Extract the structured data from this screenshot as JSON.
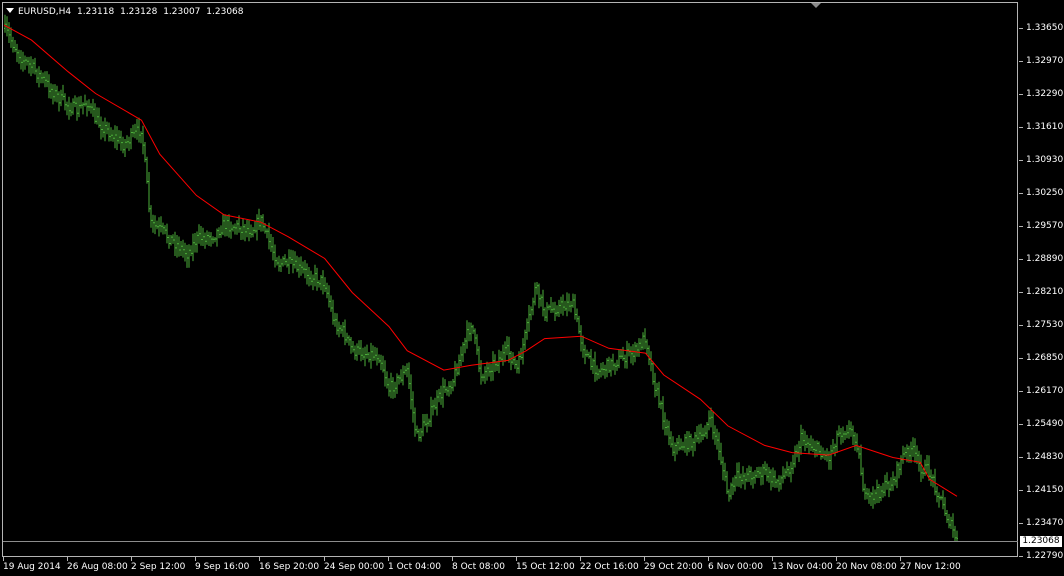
{
  "chart_header": {
    "symbol_timeframe": "EURUSD,H4",
    "open": "1.23118",
    "high": "1.23128",
    "low": "1.23007",
    "close": "1.23068"
  },
  "price_axis": {
    "labels": [
      "1.33650",
      "1.32970",
      "1.32290",
      "1.31610",
      "1.30930",
      "1.30250",
      "1.29570",
      "1.28890",
      "1.28210",
      "1.27530",
      "1.26850",
      "1.26170",
      "1.25490",
      "1.24830",
      "1.24150",
      "1.23470",
      "1.22790"
    ],
    "current_price": "1.23068"
  },
  "time_axis": {
    "labels": [
      "19 Aug 2014",
      "26 Aug 08:00",
      "2 Sep 12:00",
      "9 Sep 16:00",
      "16 Sep 20:00",
      "24 Sep 00:00",
      "1 Oct 04:00",
      "8 Oct 08:00",
      "15 Oct 12:00",
      "22 Oct 16:00",
      "29 Oct 20:00",
      "6 Nov 00:00",
      "13 Nov 04:00",
      "20 Nov 08:00",
      "27 Nov 12:00"
    ]
  },
  "colors": {
    "background": "#000000",
    "bars": "#4caf3a",
    "moving_average": "#ff0000",
    "axis_text": "#ffffff",
    "grid_frame": "#b4b4b4"
  },
  "chart_data": {
    "type": "line",
    "bar_style": "ohlc",
    "symbol": "EURUSD",
    "timeframe": "H4",
    "ylim": [
      1.2279,
      1.3404
    ],
    "x_start": "19 Aug 2014",
    "x_end": "1 Dec 2014",
    "series": [
      {
        "style": "ohlc-bars",
        "close_path": [
          [
            "19 Aug 2014",
            1.3364
          ],
          [
            "21 Aug 2014",
            1.33
          ],
          [
            "22 Aug 2014",
            1.3285
          ],
          [
            "25 Aug 2014",
            1.322
          ],
          [
            "26 Aug 2014",
            1.3205
          ],
          [
            "27 Aug 2014",
            1.3195
          ],
          [
            "28 Aug 2014",
            1.3215
          ],
          [
            "29 Aug 2014",
            1.3175
          ],
          [
            "1 Sep 2014",
            1.3125
          ],
          [
            "2 Sep 2014",
            1.314
          ],
          [
            "3 Sep 2014",
            1.316
          ],
          [
            "4 Sep 2014",
            1.296
          ],
          [
            "5 Sep 2014",
            1.295
          ],
          [
            "8 Sep 2014",
            1.29
          ],
          [
            "9 Sep 2014",
            1.293
          ],
          [
            "10 Sep 2014",
            1.2935
          ],
          [
            "11 Sep 2014",
            1.294
          ],
          [
            "12 Sep 2014",
            1.296
          ],
          [
            "15 Sep 2014",
            1.295
          ],
          [
            "16 Sep 2014",
            1.297
          ],
          [
            "17 Sep 2014",
            1.292
          ],
          [
            "18 Sep 2014",
            1.288
          ],
          [
            "19 Sep 2014",
            1.288
          ],
          [
            "22 Sep 2014",
            1.285
          ],
          [
            "23 Sep 2014",
            1.284
          ],
          [
            "24 Sep 2014",
            1.276
          ],
          [
            "25 Sep 2014",
            1.274
          ],
          [
            "26 Sep 2014",
            1.27
          ],
          [
            "29 Sep 2014",
            1.269
          ],
          [
            "30 Sep 2014",
            1.262
          ],
          [
            "1 Oct 2014",
            1.264
          ],
          [
            "2 Oct 2014",
            1.266
          ],
          [
            "3 Oct 2014",
            1.252
          ],
          [
            "6 Oct 2014",
            1.262
          ],
          [
            "7 Oct 2014",
            1.264
          ],
          [
            "8 Oct 2014",
            1.27
          ],
          [
            "9 Oct 2014",
            1.276
          ],
          [
            "10 Oct 2014",
            1.265
          ],
          [
            "13 Oct 2014",
            1.27
          ],
          [
            "14 Oct 2014",
            1.266
          ],
          [
            "15 Oct 2014",
            1.274
          ],
          [
            "16 Oct 2014",
            1.283
          ],
          [
            "17 Oct 2014",
            1.278
          ],
          [
            "20 Oct 2014",
            1.28
          ],
          [
            "21 Oct 2014",
            1.272
          ],
          [
            "22 Oct 2014",
            1.267
          ],
          [
            "23 Oct 2014",
            1.266
          ],
          [
            "24 Oct 2014",
            1.267
          ],
          [
            "27 Oct 2014",
            1.27
          ],
          [
            "28 Oct 2014",
            1.273
          ],
          [
            "29 Oct 2014",
            1.263
          ],
          [
            "30 Oct 2014",
            1.256
          ],
          [
            "31 Oct 2014",
            1.25
          ],
          [
            "3 Nov 2014",
            1.252
          ],
          [
            "4 Nov 2014",
            1.256
          ],
          [
            "5 Nov 2014",
            1.25
          ],
          [
            "6 Nov 2014",
            1.24
          ],
          [
            "7 Nov 2014",
            1.244
          ],
          [
            "10 Nov 2014",
            1.245
          ],
          [
            "11 Nov 2014",
            1.243
          ],
          [
            "12 Nov 2014",
            1.244
          ],
          [
            "13 Nov 2014",
            1.247
          ],
          [
            "14 Nov 2014",
            1.252
          ],
          [
            "17 Nov 2014",
            1.248
          ],
          [
            "18 Nov 2014",
            1.253
          ],
          [
            "19 Nov 2014",
            1.254
          ],
          [
            "20 Nov 2014",
            1.252
          ],
          [
            "21 Nov 2014",
            1.239
          ],
          [
            "24 Nov 2014",
            1.243
          ],
          [
            "25 Nov 2014",
            1.248
          ],
          [
            "26 Nov 2014",
            1.25
          ],
          [
            "27 Nov 2014",
            1.246
          ],
          [
            "28 Nov 2014",
            1.245
          ],
          [
            "1 Dec 2014",
            1.2307
          ]
        ]
      },
      {
        "style": "moving-average",
        "path": [
          [
            "19 Aug 2014",
            1.3371
          ],
          [
            "22 Aug 2014",
            1.334
          ],
          [
            "26 Aug 2014",
            1.3275
          ],
          [
            "29 Aug 2014",
            1.323
          ],
          [
            "3 Sep 2014",
            1.3175
          ],
          [
            "5 Sep 2014",
            1.3105
          ],
          [
            "9 Sep 2014",
            1.302
          ],
          [
            "12 Sep 2014",
            1.298
          ],
          [
            "16 Sep 2014",
            1.2965
          ],
          [
            "19 Sep 2014",
            1.2935
          ],
          [
            "23 Sep 2014",
            1.289
          ],
          [
            "26 Sep 2014",
            1.282
          ],
          [
            "30 Sep 2014",
            1.275
          ],
          [
            "2 Oct 2014",
            1.27
          ],
          [
            "6 Oct 2014",
            1.266
          ],
          [
            "9 Oct 2014",
            1.267
          ],
          [
            "13 Oct 2014",
            1.268
          ],
          [
            "15 Oct 2014",
            1.27
          ],
          [
            "17 Oct 2014",
            1.2725
          ],
          [
            "21 Oct 2014",
            1.273
          ],
          [
            "24 Oct 2014",
            1.2705
          ],
          [
            "28 Oct 2014",
            1.2695
          ],
          [
            "30 Oct 2014",
            1.265
          ],
          [
            "3 Nov 2014",
            1.26
          ],
          [
            "6 Nov 2014",
            1.2545
          ],
          [
            "10 Nov 2014",
            1.2505
          ],
          [
            "13 Nov 2014",
            1.249
          ],
          [
            "17 Nov 2014",
            1.2485
          ],
          [
            "20 Nov 2014",
            1.2505
          ],
          [
            "24 Nov 2014",
            1.248
          ],
          [
            "27 Nov 2014",
            1.247
          ],
          [
            "28 Nov 2014",
            1.2435
          ],
          [
            "1 Dec 2014",
            1.24
          ]
        ]
      }
    ],
    "grid": false,
    "legend": "none"
  }
}
